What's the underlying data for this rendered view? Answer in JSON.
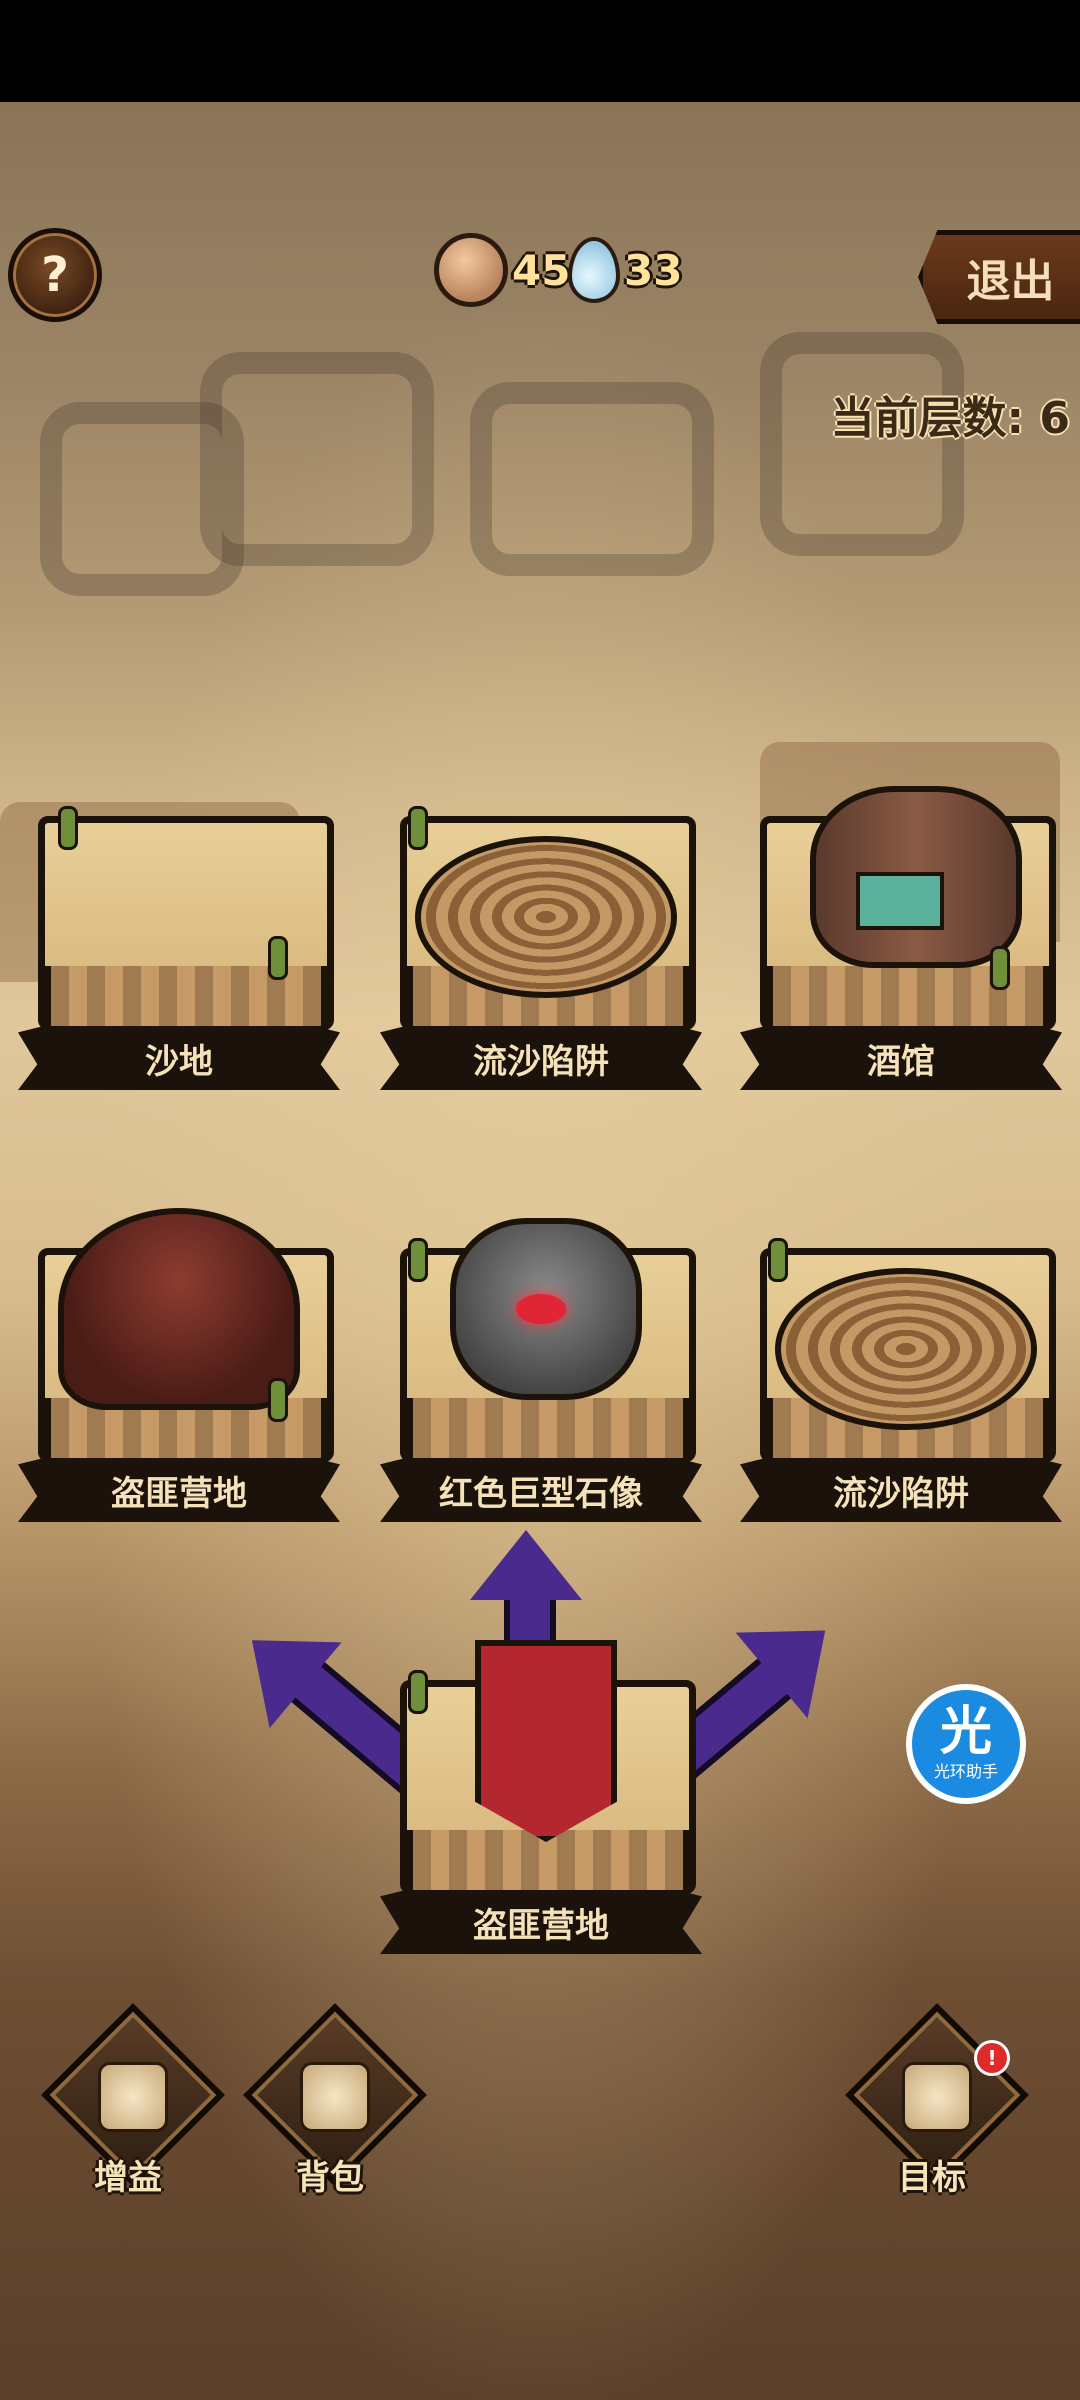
{
  "currencies": {
    "coin_value": "45",
    "drop_value": "33"
  },
  "header": {
    "exit_label": "退出",
    "floor_label": "当前层数: 6"
  },
  "tiles_row1": [
    {
      "label": "沙地"
    },
    {
      "label": "流沙陷阱"
    },
    {
      "label": "酒馆"
    }
  ],
  "tiles_row2": [
    {
      "label": "盗匪营地"
    },
    {
      "label": "红色巨型石像"
    },
    {
      "label": "流沙陷阱"
    }
  ],
  "current_tile": {
    "label": "盗匪营地"
  },
  "bottom": {
    "buff_label": "增益",
    "bag_label": "背包",
    "goal_label": "目标"
  },
  "assistant": {
    "icon_char": "光",
    "label": "光环助手"
  },
  "colors": {
    "arrow": "#4a2a8c",
    "banner": "#1a120b",
    "label_text": "#f6e2b8"
  }
}
